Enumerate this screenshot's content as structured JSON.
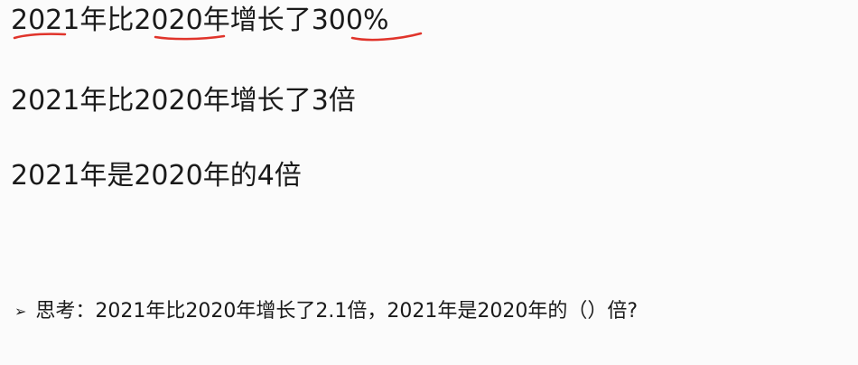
{
  "lines": [
    "2021年比2020年增长了300%",
    "2021年比2020年增长了3倍",
    "2021年是2020年的4倍"
  ],
  "question": {
    "bullet_icon": "arrow-bullet-icon",
    "text": "思考：2021年比2020年增长了2.1倍，2021年是2020年的（）倍?"
  },
  "annotation_color": "#e0342b"
}
